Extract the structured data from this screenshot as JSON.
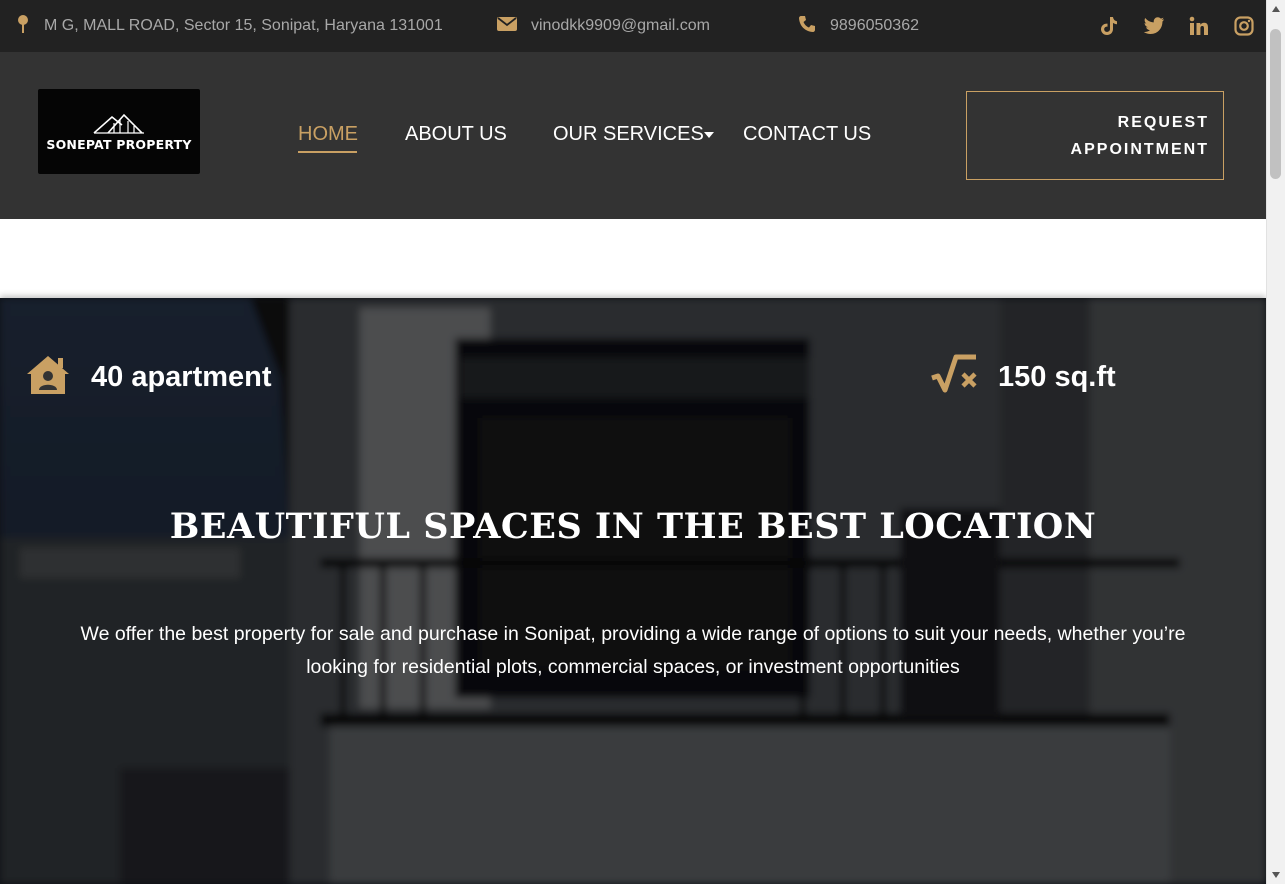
{
  "topbar": {
    "address": "M G, MALL ROAD, Sector 15, Sonipat, Haryana 131001",
    "email": "vinodkk9909@gmail.com",
    "phone": "9896050362",
    "icon_color": "#c9a063",
    "socials": [
      "tiktok-icon",
      "twitter-icon",
      "linkedin-icon",
      "instagram-icon"
    ]
  },
  "header": {
    "logo_text": "SONEPAT PROPERTY",
    "nav": {
      "home": "HOME",
      "about": "ABOUT US",
      "services": "OUR SERVICES",
      "contact": "CONTACT US"
    },
    "cta_line1": "REQUEST",
    "cta_line2": "APPOINTMENT",
    "accent_color": "#c9a063"
  },
  "hero": {
    "stat_apartments": "40 apartment",
    "stat_area": "150 sq.ft",
    "title": "BEAUTIFUL SPACES IN THE BEST LOCATION",
    "description": "We offer the best property for sale and purchase in Sonipat, providing a wide range of options to suit your needs, whether you’re looking for residential plots, commercial spaces, or investment opportunities"
  }
}
